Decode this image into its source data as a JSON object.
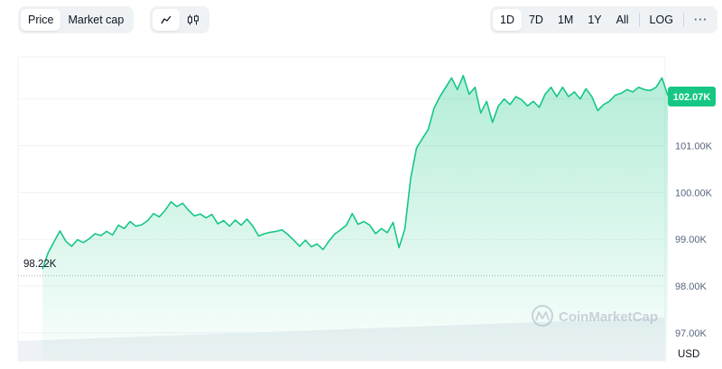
{
  "toolbar": {
    "metric_tabs": [
      {
        "label": "Price",
        "active": true
      },
      {
        "label": "Market cap",
        "active": false
      }
    ],
    "chart_type_icons": [
      {
        "icon": "line-chart-icon",
        "active": true
      },
      {
        "icon": "candlestick-icon",
        "active": false
      }
    ],
    "range_tabs": [
      {
        "label": "1D",
        "active": true
      },
      {
        "label": "7D",
        "active": false
      },
      {
        "label": "1M",
        "active": false
      },
      {
        "label": "1Y",
        "active": false
      },
      {
        "label": "All",
        "active": false
      }
    ],
    "log_label": "LOG",
    "more_label": "···"
  },
  "chart": {
    "current_price_label": "102.07K",
    "open_price_label": "98.22K",
    "currency": "USD",
    "watermark": "CoinMarketCap",
    "colors": {
      "line": "#16c784",
      "badge": "#16c784",
      "grid": "#eff2f5",
      "axis_text": "#58667e",
      "volume": "#eef1f5"
    }
  },
  "chart_data": {
    "type": "area",
    "y_ticks": [
      "97.00K",
      "98.00K",
      "99.00K",
      "100.00K",
      "101.00K"
    ],
    "ylim": [
      96.4,
      102.9
    ],
    "grid": true,
    "baseline": 98.22,
    "last_price": 102.07,
    "series": [
      {
        "values": [
          98.36,
          98.72,
          98.95,
          99.18,
          98.96,
          98.85,
          98.99,
          98.93,
          99.01,
          99.12,
          99.08,
          99.17,
          99.09,
          99.3,
          99.23,
          99.38,
          99.28,
          99.31,
          99.4,
          99.55,
          99.48,
          99.62,
          99.8,
          99.7,
          99.77,
          99.62,
          99.5,
          99.54,
          99.46,
          99.53,
          99.33,
          99.4,
          99.28,
          99.41,
          99.3,
          99.43,
          99.28,
          99.07,
          99.12,
          99.15,
          99.17,
          99.2,
          99.1,
          98.98,
          98.85,
          98.98,
          98.84,
          98.9,
          98.78,
          98.96,
          99.11,
          99.2,
          99.3,
          99.55,
          99.32,
          99.38,
          99.3,
          99.12,
          99.23,
          99.14,
          99.36,
          98.82,
          99.22,
          100.3,
          100.95,
          101.15,
          101.35,
          101.8,
          102.05,
          102.25,
          102.45,
          102.2,
          102.5,
          102.1,
          102.25,
          101.7,
          101.95,
          101.5,
          101.85,
          102.0,
          101.88,
          102.05,
          101.98,
          101.85,
          101.95,
          101.82,
          102.1,
          102.25,
          102.05,
          102.25,
          102.05,
          102.15,
          102.0,
          102.22,
          102.05,
          101.75,
          101.88,
          101.95,
          102.08,
          102.12,
          102.2,
          102.15,
          102.25,
          102.2,
          102.18,
          102.25,
          102.45,
          102.07
        ]
      }
    ],
    "volume_range": [
      0,
      1
    ]
  }
}
